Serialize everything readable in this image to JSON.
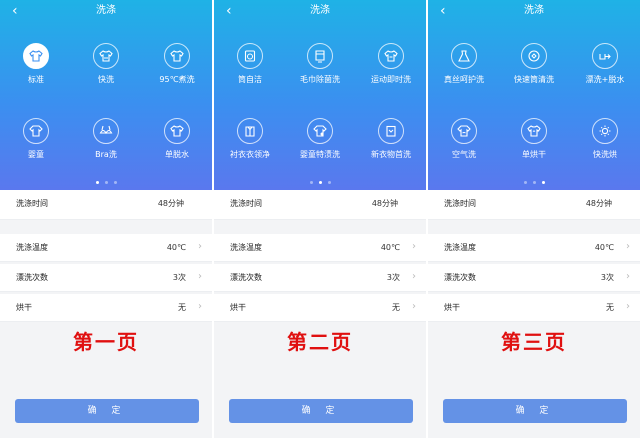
{
  "colors": {
    "accent": "#5a78ee",
    "header_top": "#1fb2e6",
    "page_label": "#e01010",
    "confirm_button": "#6492e6"
  },
  "pages": [
    {
      "title": "洗涤",
      "page_label": "第一页",
      "modes": [
        {
          "label": "标准",
          "icon": "tshirt-icon",
          "selected": true
        },
        {
          "label": "快洗",
          "icon": "quick-wash-icon",
          "selected": false
        },
        {
          "label": "95℃煮洗",
          "icon": "tshirt-icon",
          "selected": false
        },
        {
          "label": "婴童",
          "icon": "baby-clothes-icon",
          "selected": false
        },
        {
          "label": "Bra洗",
          "icon": "bra-icon",
          "selected": false
        },
        {
          "label": "单脱水",
          "icon": "tshirt-icon",
          "selected": false
        }
      ],
      "active_dot": 0,
      "rows": [
        {
          "label": "洗涤时间",
          "value": "48分钟",
          "chevron": false
        },
        {
          "label": "洗涤温度",
          "value": "40℃",
          "chevron": true
        },
        {
          "label": "漂洗次数",
          "value": "3次",
          "chevron": true
        },
        {
          "label": "烘干",
          "value": "无",
          "chevron": true
        }
      ],
      "confirm_label": "确 定"
    },
    {
      "title": "洗涤",
      "page_label": "第二页",
      "modes": [
        {
          "label": "筒自洁",
          "icon": "drum-clean-icon",
          "selected": false
        },
        {
          "label": "毛巾除菌洗",
          "icon": "towel-icon",
          "selected": false
        },
        {
          "label": "运动即时洗",
          "icon": "sport-shirt-icon",
          "selected": false
        },
        {
          "label": "衬衣衣领净",
          "icon": "shirt-collar-icon",
          "selected": false
        },
        {
          "label": "婴童特渍洗",
          "icon": "baby-clothes-icon",
          "selected": false
        },
        {
          "label": "新衣物首洗",
          "icon": "new-clothes-icon",
          "selected": false
        }
      ],
      "active_dot": 1,
      "rows": [
        {
          "label": "洗涤时间",
          "value": "48分钟",
          "chevron": false
        },
        {
          "label": "洗涤温度",
          "value": "40℃",
          "chevron": true
        },
        {
          "label": "漂洗次数",
          "value": "3次",
          "chevron": true
        },
        {
          "label": "烘干",
          "value": "无",
          "chevron": true
        }
      ],
      "confirm_label": "确 定"
    },
    {
      "title": "洗涤",
      "page_label": "第三页",
      "modes": [
        {
          "label": "真丝呵护洗",
          "icon": "dress-icon",
          "selected": false
        },
        {
          "label": "快速筒清洗",
          "icon": "drum-fast-icon",
          "selected": false
        },
        {
          "label": "漂洗+脱水",
          "icon": "rinse-spin-icon",
          "selected": false
        },
        {
          "label": "空气洗",
          "icon": "air-wash-icon",
          "selected": false
        },
        {
          "label": "单烘干",
          "icon": "dry-icon",
          "selected": false
        },
        {
          "label": "快洗烘",
          "icon": "sun-icon",
          "selected": false
        }
      ],
      "active_dot": 2,
      "rows": [
        {
          "label": "洗涤时间",
          "value": "48分钟",
          "chevron": false
        },
        {
          "label": "洗涤温度",
          "value": "40℃",
          "chevron": true
        },
        {
          "label": "漂洗次数",
          "value": "3次",
          "chevron": true
        },
        {
          "label": "烘干",
          "value": "无",
          "chevron": true
        }
      ],
      "confirm_label": "确 定"
    }
  ]
}
